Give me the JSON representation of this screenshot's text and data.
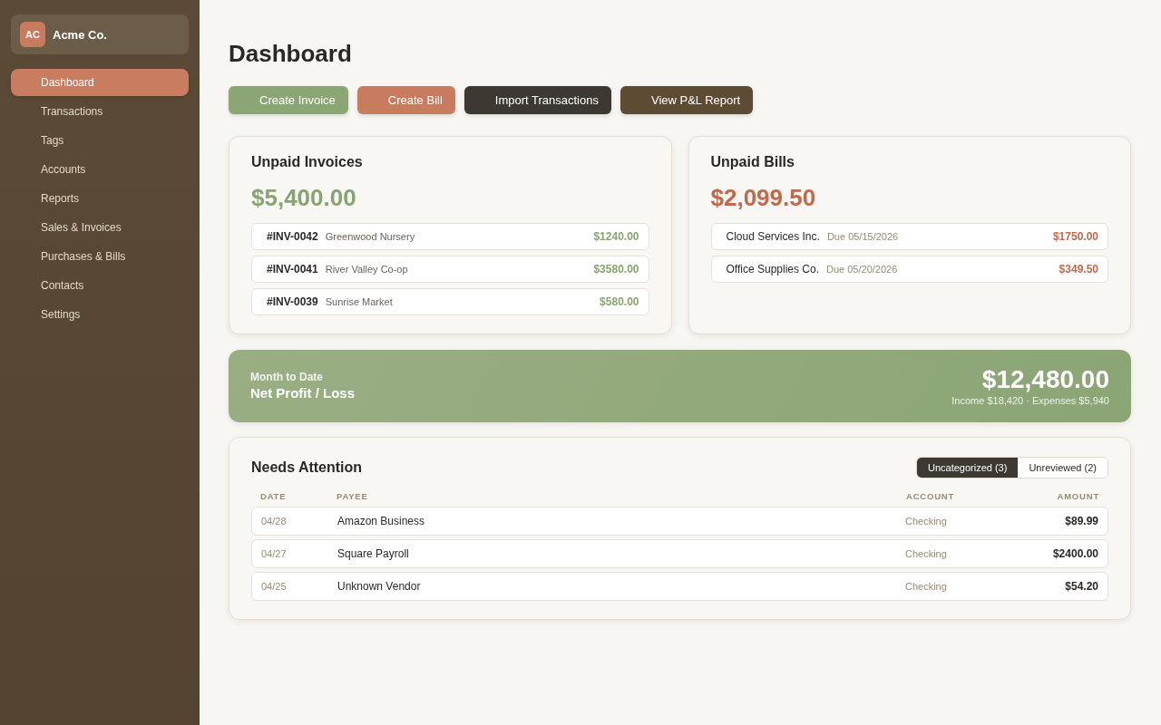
{
  "sidebar": {
    "brand": {
      "initials": "AC",
      "name": "Acme Co."
    },
    "items": [
      {
        "label": "Dashboard",
        "selected": true
      },
      {
        "label": "Transactions",
        "selected": false
      },
      {
        "label": "Tags",
        "selected": false
      },
      {
        "label": "Accounts",
        "selected": false
      },
      {
        "label": "Reports",
        "selected": false
      },
      {
        "label": "Sales & Invoices",
        "selected": false
      },
      {
        "label": "Purchases & Bills",
        "selected": false
      },
      {
        "label": "Contacts",
        "selected": false
      },
      {
        "label": "Settings",
        "selected": false
      }
    ]
  },
  "page": {
    "title": "Dashboard"
  },
  "actions": [
    {
      "label": "Create Invoice",
      "color": "#8ca574"
    },
    {
      "label": "Create Bill",
      "color": "#c97b5f"
    },
    {
      "label": "Import Transactions",
      "color": "#3d3832"
    },
    {
      "label": "View P&L Report",
      "color": "#5e4b33"
    }
  ],
  "unpaid_invoices": {
    "title": "Unpaid Invoices",
    "total": "$5,400.00",
    "items": [
      {
        "number": "#INV-0042",
        "customer": "Greenwood Nursery",
        "amount": "$1240.00"
      },
      {
        "number": "#INV-0041",
        "customer": "River Valley Co-op",
        "amount": "$3580.00"
      },
      {
        "number": "#INV-0039",
        "customer": "Sunrise Market",
        "amount": "$580.00"
      }
    ]
  },
  "unpaid_bills": {
    "title": "Unpaid Bills",
    "total": "$2,099.50",
    "items": [
      {
        "vendor": "Cloud Services Inc.",
        "due": "Due 05/15/2026",
        "amount": "$1750.00"
      },
      {
        "vendor": "Office Supplies Co.",
        "due": "Due 05/20/2026",
        "amount": "$349.50"
      }
    ]
  },
  "net_profit": {
    "period": "Month to Date",
    "title": "Net Profit / Loss",
    "amount": "$12,480.00",
    "breakdown": "Income $18,420 · Expenses $5,940"
  },
  "needs_attention": {
    "title": "Needs Attention",
    "tabs": [
      {
        "label": "Uncategorized (3)",
        "selected": true
      },
      {
        "label": "Unreviewed (2)",
        "selected": false
      }
    ],
    "table": {
      "columns": [
        "DATE",
        "PAYEE",
        "ACCOUNT",
        "AMOUNT"
      ],
      "rows": [
        {
          "date": "04/28",
          "payee": "Amazon Business",
          "account": "Checking",
          "amount": "$89.99"
        },
        {
          "date": "04/27",
          "payee": "Square Payroll",
          "account": "Checking",
          "amount": "$2400.00"
        },
        {
          "date": "04/25",
          "payee": "Unknown Vendor",
          "account": "Checking",
          "amount": "$54.20"
        }
      ]
    }
  }
}
